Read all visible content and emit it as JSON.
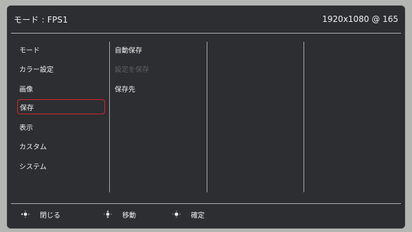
{
  "header": {
    "mode_title": "モード : FPS1",
    "resolution": "1920x1080 @ 165"
  },
  "menu": {
    "items": [
      {
        "label": "モード"
      },
      {
        "label": "カラー設定"
      },
      {
        "label": "画像"
      },
      {
        "label": "保存"
      },
      {
        "label": "表示"
      },
      {
        "label": "カスタム"
      },
      {
        "label": "システム"
      }
    ],
    "selected_index": 3
  },
  "submenu": {
    "items": [
      {
        "label": "自動保存",
        "enabled": true
      },
      {
        "label": "設定を保存",
        "enabled": false
      },
      {
        "label": "保存先",
        "enabled": true
      }
    ]
  },
  "footer": {
    "close_label": "閉じる",
    "move_label": "移動",
    "confirm_label": "確定"
  },
  "colors": {
    "selection_border": "#d7262e",
    "panel_bg": "#2d2e31",
    "disabled_text": "#5e6064"
  }
}
